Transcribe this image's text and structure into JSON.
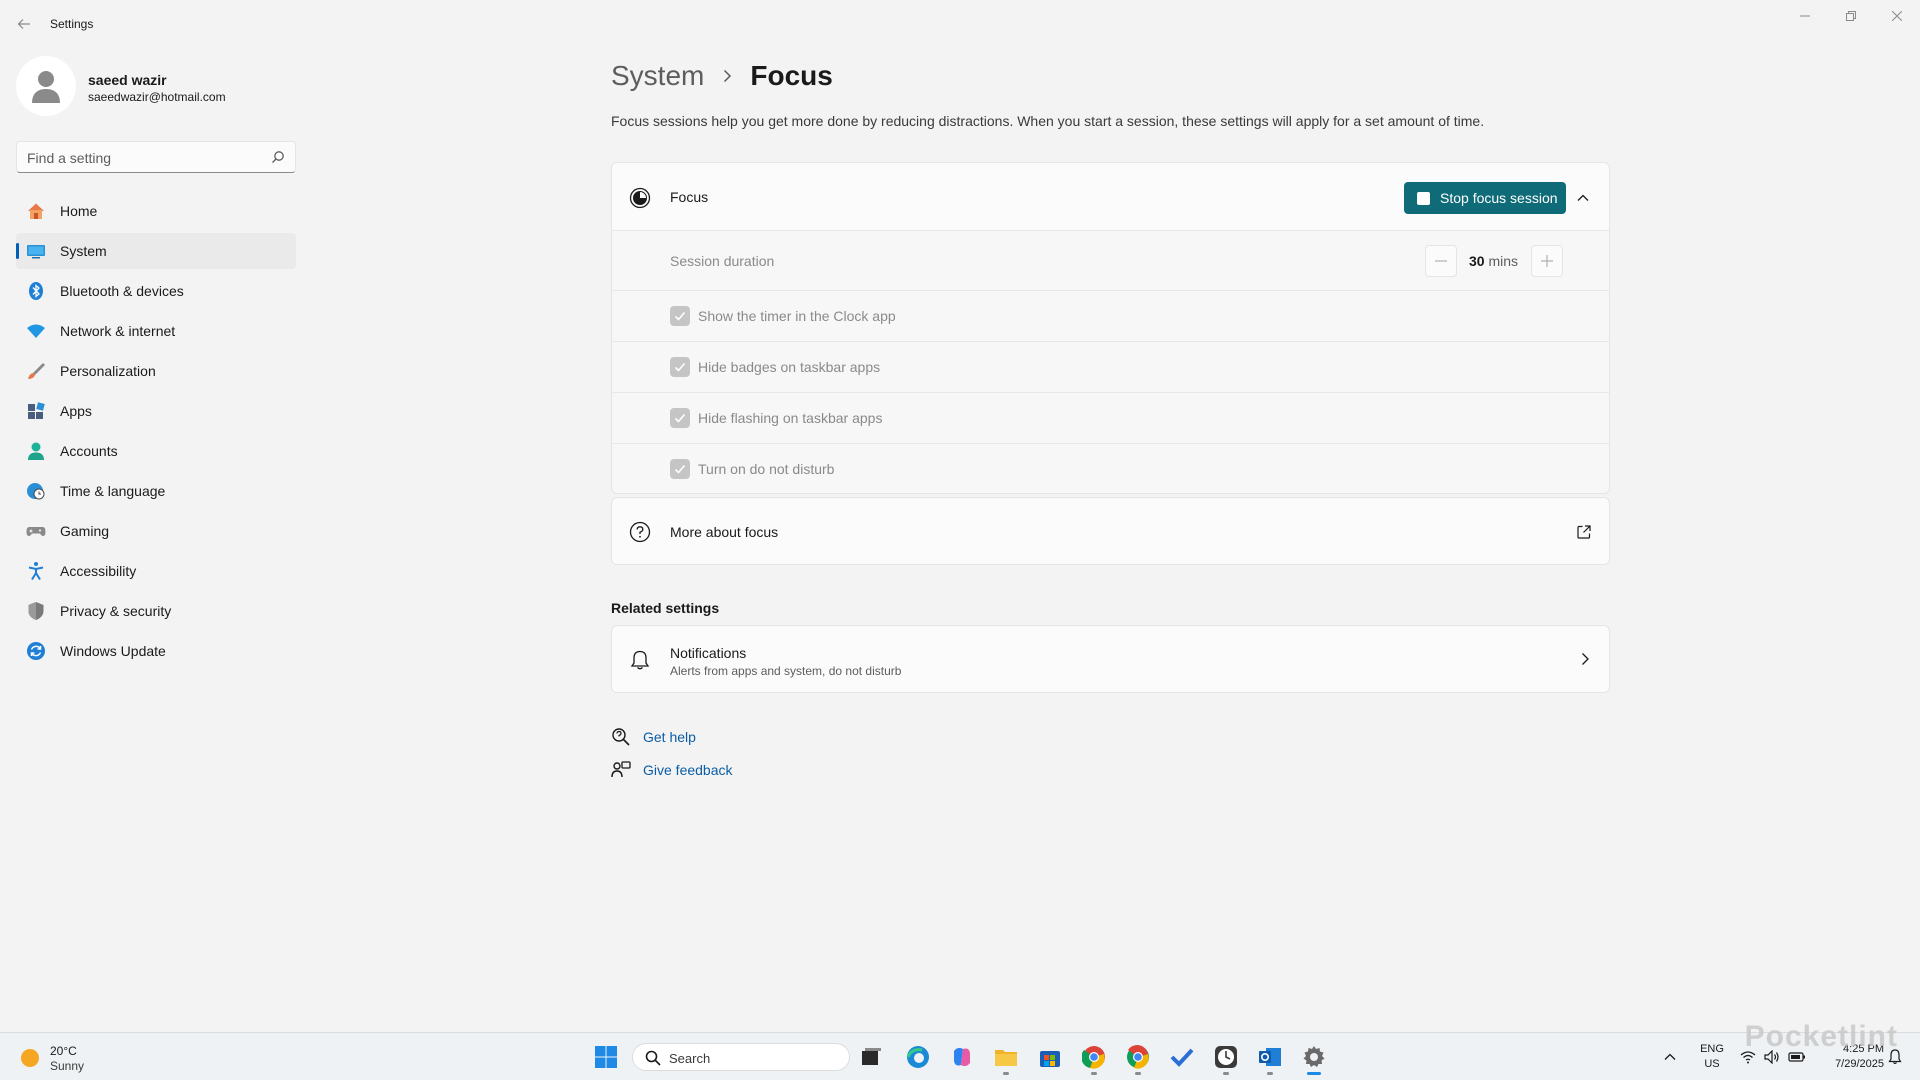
{
  "window": {
    "title": "Settings"
  },
  "profile": {
    "name": "saeed wazir",
    "email": "saeedwazir@hotmail.com"
  },
  "search": {
    "placeholder": "Find a setting"
  },
  "sidebar": {
    "items": [
      {
        "label": "Home",
        "icon": "home-icon"
      },
      {
        "label": "System",
        "icon": "system-icon",
        "active": true
      },
      {
        "label": "Bluetooth & devices",
        "icon": "bluetooth-icon"
      },
      {
        "label": "Network & internet",
        "icon": "wifi-icon"
      },
      {
        "label": "Personalization",
        "icon": "brush-icon"
      },
      {
        "label": "Apps",
        "icon": "apps-icon"
      },
      {
        "label": "Accounts",
        "icon": "accounts-icon"
      },
      {
        "label": "Time & language",
        "icon": "globe-clock-icon"
      },
      {
        "label": "Gaming",
        "icon": "controller-icon"
      },
      {
        "label": "Accessibility",
        "icon": "accessibility-icon"
      },
      {
        "label": "Privacy & security",
        "icon": "shield-icon"
      },
      {
        "label": "Windows Update",
        "icon": "update-icon"
      }
    ]
  },
  "breadcrumb": {
    "parent": "System",
    "current": "Focus"
  },
  "description": "Focus sessions help you get more done by reducing distractions. When you start a session, these settings will apply for a set amount of time.",
  "focus": {
    "title": "Focus",
    "stop_button": "Stop focus session",
    "session_duration_label": "Session duration",
    "duration_value": "30",
    "duration_unit": "mins",
    "options": [
      {
        "label": "Show the timer in the Clock app",
        "checked": true
      },
      {
        "label": "Hide badges on taskbar apps",
        "checked": true
      },
      {
        "label": "Hide flashing on taskbar apps",
        "checked": true
      },
      {
        "label": "Turn on do not disturb",
        "checked": true
      }
    ]
  },
  "more_about": {
    "label": "More about focus"
  },
  "related": {
    "title": "Related settings",
    "notifications": {
      "title": "Notifications",
      "subtitle": "Alerts from apps and system, do not disturb"
    }
  },
  "links": {
    "get_help": "Get help",
    "give_feedback": "Give feedback"
  },
  "taskbar": {
    "weather": {
      "temp": "20°C",
      "condition": "Sunny"
    },
    "search_label": "Search",
    "language": {
      "line1": "ENG",
      "line2": "US"
    },
    "time": "4:25 PM",
    "date": "7/29/2025"
  },
  "watermark": "Pocketlint",
  "colors": {
    "accent": "#0f6b78",
    "nav_indicator": "#005fb8",
    "link": "#0b5ea6"
  }
}
